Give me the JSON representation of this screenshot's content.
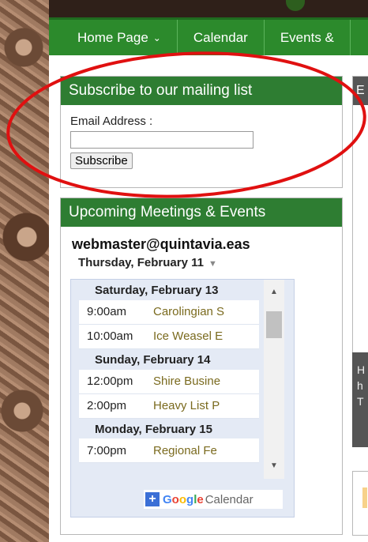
{
  "nav": {
    "items": [
      {
        "label": "Home Page",
        "has_dropdown": true
      },
      {
        "label": "Calendar"
      },
      {
        "label": "Events &"
      }
    ]
  },
  "mailing": {
    "title": "Subscribe to our mailing list",
    "email_label": "Email Address :",
    "email_value": "",
    "subscribe_label": "Subscribe"
  },
  "events_widget": {
    "title": "Upcoming Meetings & Events",
    "calendar_name": "webmaster@quintavia.eas",
    "current_date": "Thursday, February 11",
    "days": [
      {
        "date": "Saturday, February 13",
        "events": [
          {
            "time": "9:00am",
            "title": "Carolingian S"
          },
          {
            "time": "10:00am",
            "title": "Ice Weasel E"
          }
        ]
      },
      {
        "date": "Sunday, February 14",
        "events": [
          {
            "time": "12:00pm",
            "title": "Shire Busine"
          },
          {
            "time": "2:00pm",
            "title": "Heavy List P"
          }
        ]
      },
      {
        "date": "Monday, February 15",
        "events": [
          {
            "time": "7:00pm",
            "title": "Regional Fe"
          }
        ]
      }
    ],
    "footer": {
      "plus": "+",
      "google": "Google",
      "calendar": "Calendar"
    }
  },
  "right_column": {
    "dark_lines": [
      "H",
      "h",
      "T"
    ],
    "top_letter": "E"
  },
  "colors": {
    "nav_green": "#2c8a2c",
    "header_green": "#2e7d32",
    "annotation_red": "#e01010"
  }
}
